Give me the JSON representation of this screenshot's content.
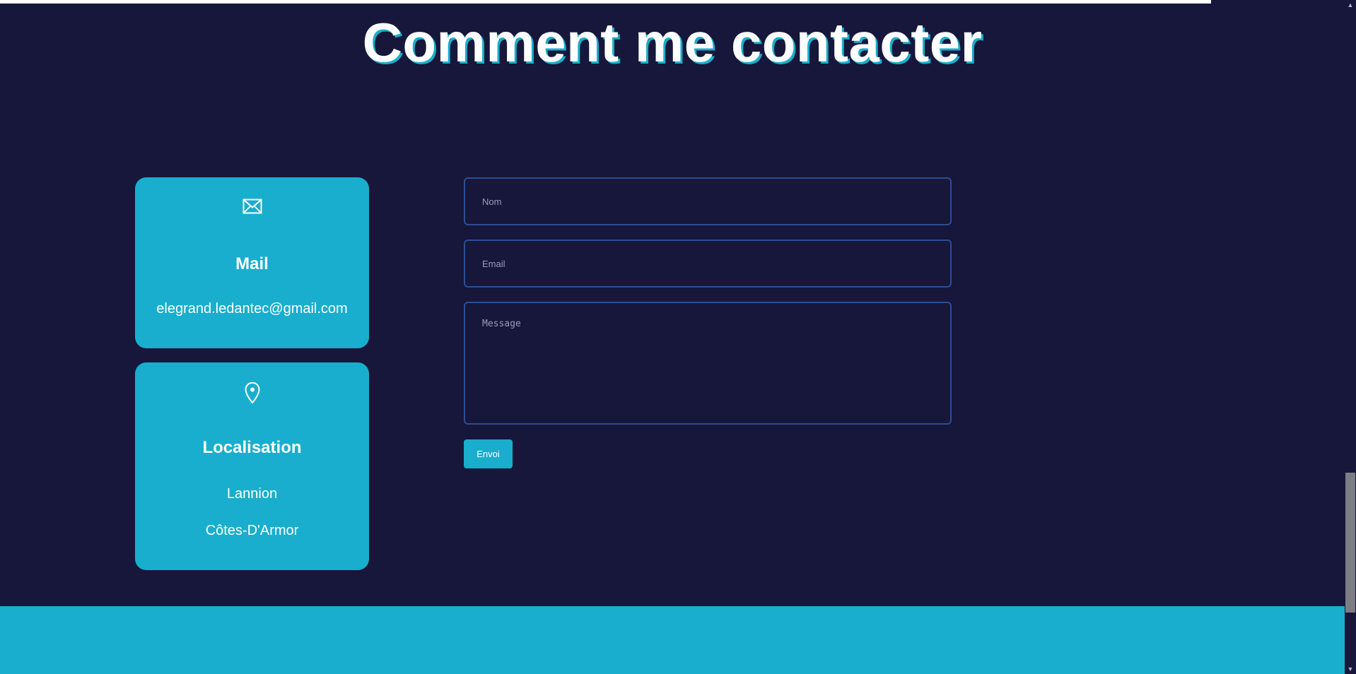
{
  "page": {
    "title": "Comment me contacter"
  },
  "cards": {
    "mail": {
      "icon": "envelope-icon",
      "title": "Mail",
      "value": "elegrand.ledantec@gmail.com"
    },
    "location": {
      "icon": "map-pin-icon",
      "title": "Localisation",
      "city": "Lannion",
      "region": "Côtes-D'Armor"
    }
  },
  "form": {
    "name_placeholder": "Nom",
    "email_placeholder": "Email",
    "message_placeholder": "Message",
    "submit_label": "Envoi"
  },
  "colors": {
    "background": "#16173a",
    "accent": "#19aecd",
    "input_border": "#2a4e96",
    "text": "#ffffff"
  },
  "icons": {
    "scroll_up": "chevron-up-icon",
    "scroll_down": "chevron-down-icon"
  }
}
